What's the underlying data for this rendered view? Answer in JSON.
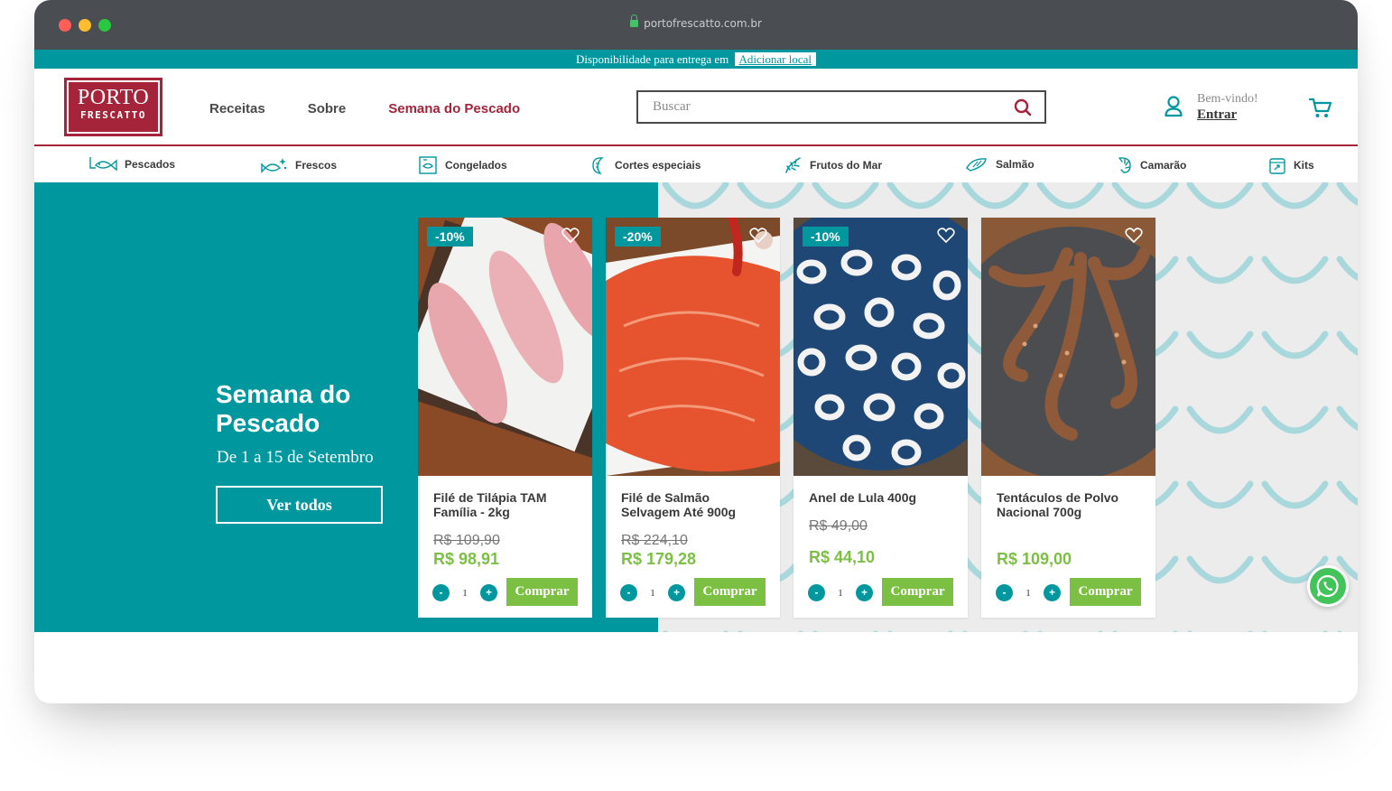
{
  "browser": {
    "url": "portofrescatto.com.br"
  },
  "delivery_bar": {
    "text": "Disponibilidade para entrega em",
    "link": "Adicionar local"
  },
  "logo": {
    "line1": "PORTO",
    "line2": "FRESCATTO"
  },
  "main_nav": [
    {
      "label": "Receitas"
    },
    {
      "label": "Sobre"
    },
    {
      "label": "Semana do Pescado",
      "highlight": true
    }
  ],
  "search": {
    "placeholder": "Buscar"
  },
  "user": {
    "welcome": "Bem-vindo!",
    "login": "Entrar"
  },
  "categories": [
    {
      "label": "Pescados",
      "icon": "fish-icon"
    },
    {
      "label": "Frescos",
      "icon": "fresh-fish-icon"
    },
    {
      "label": "Congelados",
      "icon": "frozen-icon"
    },
    {
      "label": "Cortes especiais",
      "icon": "special-cut-icon"
    },
    {
      "label": "Frutos do Mar",
      "icon": "seafood-icon"
    },
    {
      "label": "Salmão",
      "icon": "salmon-icon"
    },
    {
      "label": "Camarão",
      "icon": "shrimp-icon"
    },
    {
      "label": "Kits",
      "icon": "kit-box-icon"
    }
  ],
  "hero": {
    "title": "Semana do Pescado",
    "subtitle": "De 1 a 15 de Setembro",
    "button": "Ver todos"
  },
  "products": [
    {
      "name": "Filé de Tilápia TAM Família - 2kg",
      "discount": "-10%",
      "old_price": "R$ 109,90",
      "price": "R$ 98,91",
      "qty": "1",
      "buy": "Comprar"
    },
    {
      "name": "Filé de Salmão Selvagem Até 900g",
      "discount": "-20%",
      "old_price": "R$ 224,10",
      "price": "R$ 179,28",
      "qty": "1",
      "buy": "Comprar"
    },
    {
      "name": "Anel de Lula 400g",
      "discount": "-10%",
      "old_price": "R$ 49,00",
      "price": "R$ 44,10",
      "qty": "1",
      "buy": "Comprar"
    },
    {
      "name": "Tentáculos de Polvo Nacional 700g",
      "discount": "",
      "old_price": "",
      "price": "R$ 109,00",
      "qty": "1",
      "buy": "Comprar"
    }
  ],
  "qty_controls": {
    "minus": "-",
    "plus": "+"
  },
  "colors": {
    "teal": "#00989e",
    "brand_red": "#a5243a",
    "price_green": "#7cc043"
  }
}
